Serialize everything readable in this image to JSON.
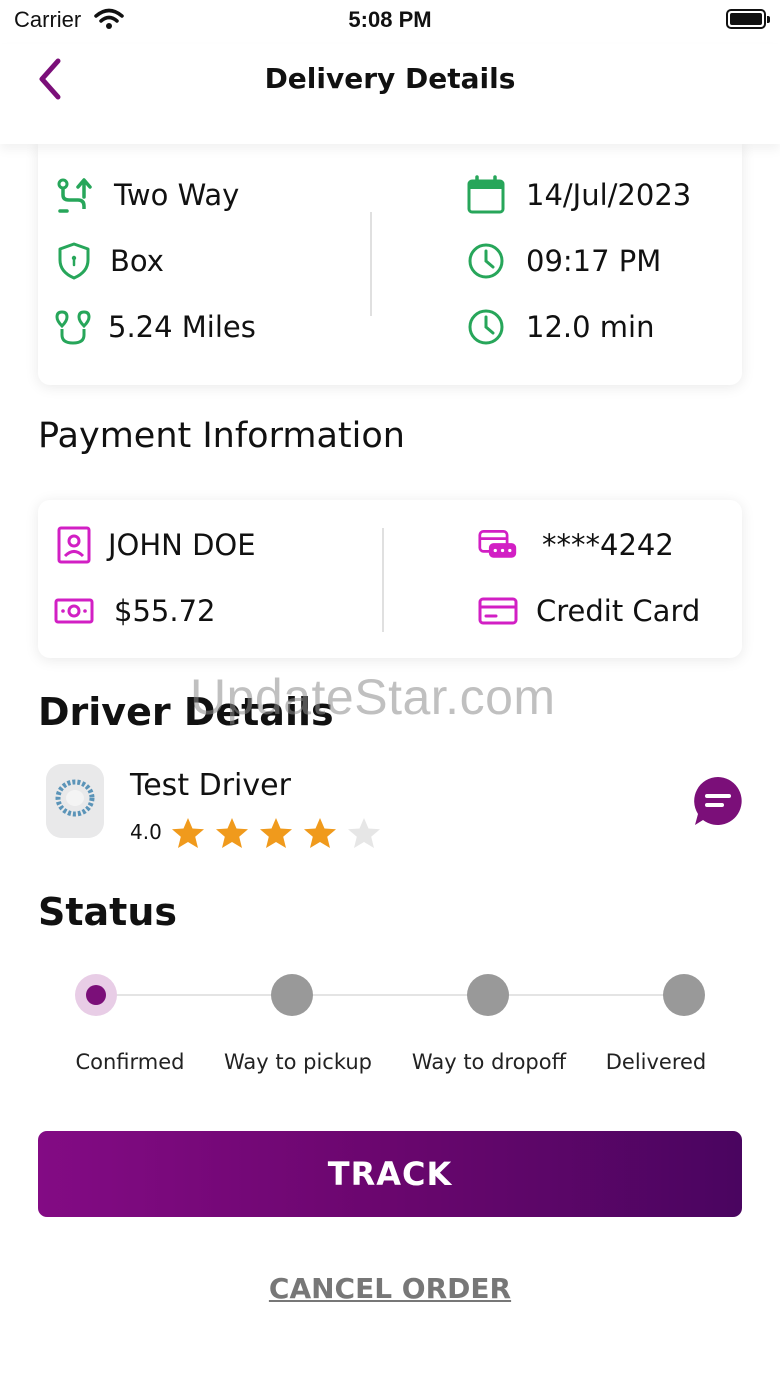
{
  "status_bar": {
    "carrier": "Carrier",
    "time": "5:08 PM"
  },
  "nav": {
    "title": "Delivery Details"
  },
  "delivery": {
    "trip_type": "Two Way",
    "package": "Box",
    "distance": "5.24 Miles",
    "date": "14/Jul/2023",
    "time": "09:17 PM",
    "duration": "12.0 min"
  },
  "payment": {
    "title": "Payment Information",
    "name": "JOHN DOE",
    "amount": "$55.72",
    "card_number": "****4242",
    "card_type": "Credit Card"
  },
  "driver": {
    "title": "Driver Details",
    "name": "Test Driver",
    "rating": "4.0",
    "rating_value": 4,
    "rating_max": 5
  },
  "status": {
    "title": "Status",
    "steps": [
      {
        "label": "Confirmed",
        "active": true
      },
      {
        "label": "Way to pickup",
        "active": false
      },
      {
        "label": "Way to dropoff",
        "active": false
      },
      {
        "label": "Delivered",
        "active": false
      }
    ]
  },
  "actions": {
    "track": "TRACK",
    "cancel": "CANCEL ORDER"
  },
  "watermark": "UpdateStar.com",
  "colors": {
    "brand": "#7b0f79",
    "green": "#27a65a",
    "magenta": "#d21fc4",
    "star": "#f09a1c",
    "star_empty": "#e6e6e6"
  }
}
